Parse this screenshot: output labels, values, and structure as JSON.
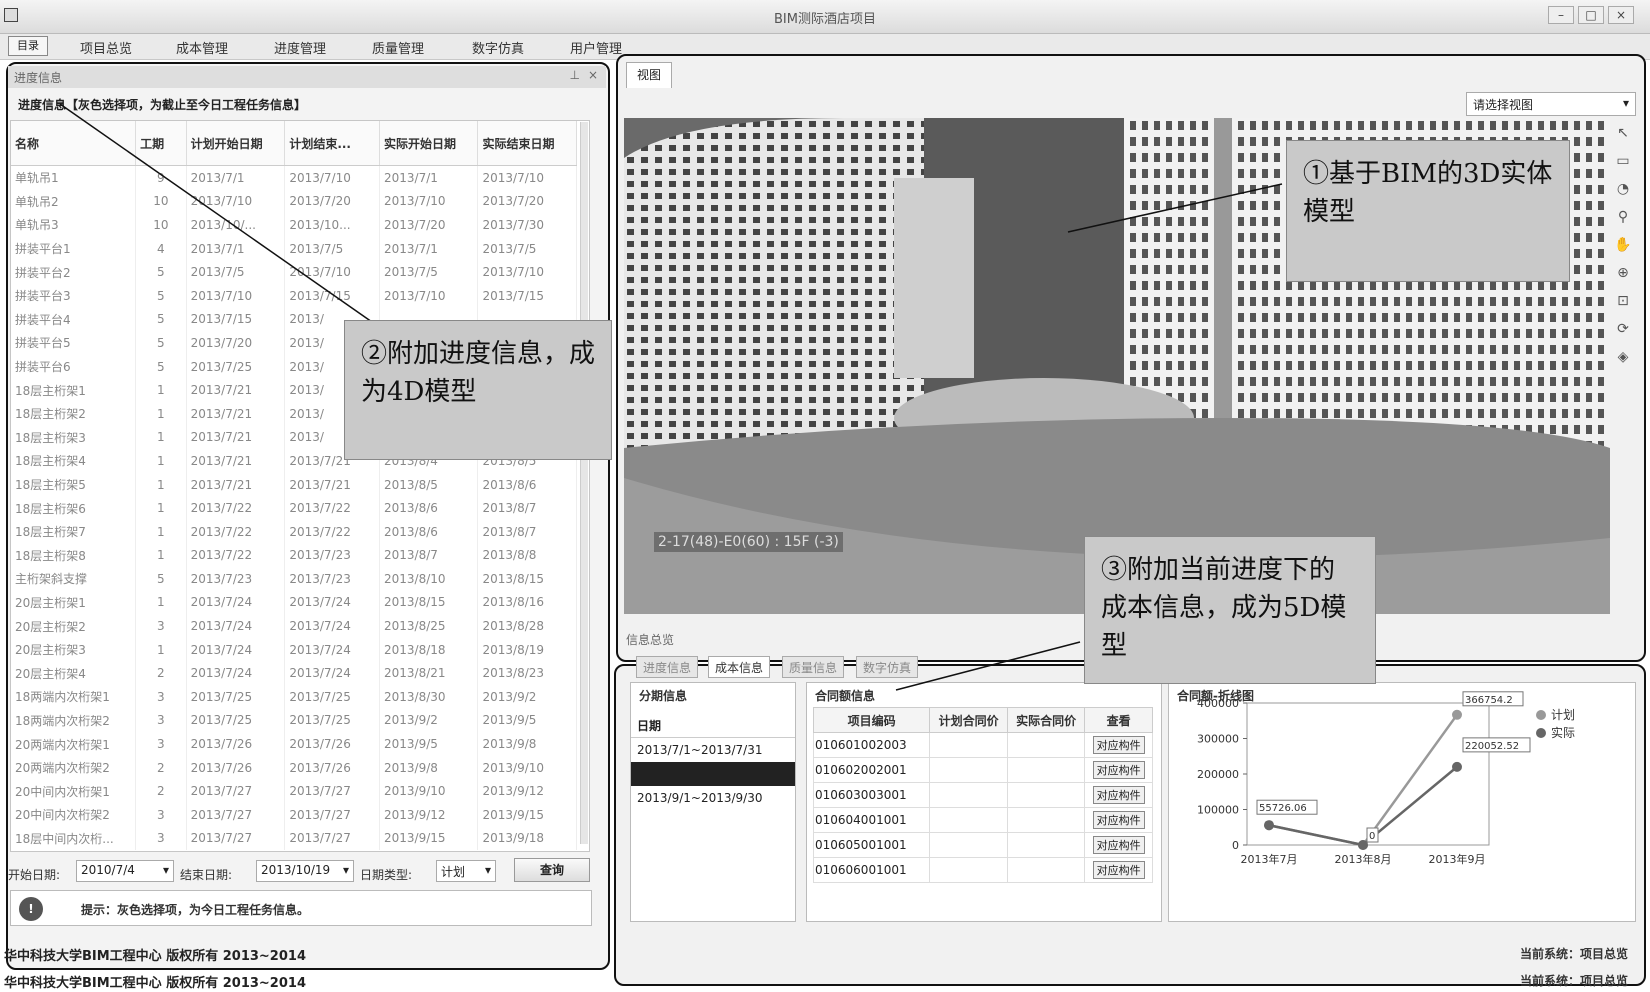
{
  "window": {
    "title": "BIM测际酒店项目",
    "min": "–",
    "max": "□",
    "close": "×"
  },
  "menu": {
    "home_label": "目录",
    "items": [
      "项目总览",
      "成本管理",
      "进度管理",
      "质量管理",
      "数字仿真",
      "用户管理"
    ]
  },
  "left": {
    "panel_title": "进度信息",
    "caption": "进度信息【灰色选择项，为截止至今日工程任务信息】",
    "columns": [
      "名称",
      "工期",
      "计划开始日期",
      "计划结束...",
      "实际开始日期",
      "实际结束日期"
    ],
    "rows": [
      [
        "单轨吊1",
        "9",
        "2013/7/1",
        "2013/7/10",
        "2013/7/1",
        "2013/7/10"
      ],
      [
        "单轨吊2",
        "10",
        "2013/7/10",
        "2013/7/20",
        "2013/7/10",
        "2013/7/20"
      ],
      [
        "单轨吊3",
        "10",
        "2013/10/...",
        "2013/10...",
        "2013/7/20",
        "2013/7/30"
      ],
      [
        "拼装平台1",
        "4",
        "2013/7/1",
        "2013/7/5",
        "2013/7/1",
        "2013/7/5"
      ],
      [
        "拼装平台2",
        "5",
        "2013/7/5",
        "2013/7/10",
        "2013/7/5",
        "2013/7/10"
      ],
      [
        "拼装平台3",
        "5",
        "2013/7/10",
        "2013/7/15",
        "2013/7/10",
        "2013/7/15"
      ],
      [
        "拼装平台4",
        "5",
        "2013/7/15",
        "2013/",
        "",
        ""
      ],
      [
        "拼装平台5",
        "5",
        "2013/7/20",
        "2013/",
        "",
        ""
      ],
      [
        "拼装平台6",
        "5",
        "2013/7/25",
        "2013/",
        "",
        ""
      ],
      [
        "18层主桁架1",
        "1",
        "2013/7/21",
        "2013/",
        "",
        ""
      ],
      [
        "18层主桁架2",
        "1",
        "2013/7/21",
        "2013/",
        "",
        ""
      ],
      [
        "18层主桁架3",
        "1",
        "2013/7/21",
        "2013/",
        "",
        ""
      ],
      [
        "18层主桁架4",
        "1",
        "2013/7/21",
        "2013/7/21",
        "2013/8/4",
        "2013/8/5"
      ],
      [
        "18层主桁架5",
        "1",
        "2013/7/21",
        "2013/7/21",
        "2013/8/5",
        "2013/8/6"
      ],
      [
        "18层主桁架6",
        "1",
        "2013/7/22",
        "2013/7/22",
        "2013/8/6",
        "2013/8/7"
      ],
      [
        "18层主桁架7",
        "1",
        "2013/7/22",
        "2013/7/22",
        "2013/8/6",
        "2013/8/7"
      ],
      [
        "18层主桁架8",
        "1",
        "2013/7/22",
        "2013/7/23",
        "2013/8/7",
        "2013/8/8"
      ],
      [
        "主桁架斜支撑",
        "5",
        "2013/7/23",
        "2013/7/23",
        "2013/8/10",
        "2013/8/15"
      ],
      [
        "20层主桁架1",
        "1",
        "2013/7/24",
        "2013/7/24",
        "2013/8/15",
        "2013/8/16"
      ],
      [
        "20层主桁架2",
        "3",
        "2013/7/24",
        "2013/7/24",
        "2013/8/25",
        "2013/8/28"
      ],
      [
        "20层主桁架3",
        "1",
        "2013/7/24",
        "2013/7/24",
        "2013/8/18",
        "2013/8/19"
      ],
      [
        "20层主桁架4",
        "2",
        "2013/7/24",
        "2013/7/24",
        "2013/8/21",
        "2013/8/23"
      ],
      [
        "18两端内次桁架1",
        "3",
        "2013/7/25",
        "2013/7/25",
        "2013/8/30",
        "2013/9/2"
      ],
      [
        "18两端内次桁架2",
        "3",
        "2013/7/25",
        "2013/7/25",
        "2013/9/2",
        "2013/9/5"
      ],
      [
        "20两端内次桁架1",
        "3",
        "2013/7/26",
        "2013/7/26",
        "2013/9/5",
        "2013/9/8"
      ],
      [
        "20两端内次桁架2",
        "2",
        "2013/7/26",
        "2013/7/26",
        "2013/9/8",
        "2013/9/10"
      ],
      [
        "20中间内次桁架1",
        "2",
        "2013/7/27",
        "2013/7/27",
        "2013/9/10",
        "2013/9/12"
      ],
      [
        "20中间内次桁架2",
        "3",
        "2013/7/27",
        "2013/7/27",
        "2013/9/12",
        "2013/9/15"
      ],
      [
        "18层中间内次桁...",
        "3",
        "2013/7/27",
        "2013/7/27",
        "2013/9/15",
        "2013/9/18"
      ]
    ],
    "filter": {
      "start_label": "开始日期:",
      "start_value": "2010/7/4",
      "end_label": "结束日期:",
      "end_value": "2013/10/19",
      "type_label": "日期类型:",
      "type_value": "计划",
      "query": "查询"
    },
    "tip": "提示：灰色选择项，为今日工程任务信息。"
  },
  "view": {
    "tab": "视图",
    "select_placeholder": "请选择视图",
    "coord_readout": "2-17(48)-E0(60) : 15F (-3)"
  },
  "info": {
    "panel_title": "信息总览",
    "tabs": [
      "进度信息",
      "成本信息",
      "质量信息",
      "数字仿真"
    ],
    "period": {
      "title": "分期信息",
      "col": "日期",
      "rows": [
        "2013/7/1~2013/7/31",
        "",
        "2013/9/1~2013/9/30"
      ]
    },
    "contract": {
      "title": "合同额信息",
      "columns": [
        "项目编码",
        "计划合同价",
        "实际合同价",
        "查看"
      ],
      "codes": [
        "010601002003",
        "010602002001",
        "010603003001",
        "010604001001",
        "010605001001",
        "010606001001"
      ],
      "button": "对应构件"
    }
  },
  "chart_data": {
    "type": "line",
    "title": "合同额-折线图",
    "categories": [
      "2013年7月",
      "2013年8月",
      "2013年9月"
    ],
    "series": [
      {
        "name": "计划",
        "values": [
          55726.06,
          0,
          366754.2
        ]
      },
      {
        "name": "实际",
        "values": [
          55726.06,
          0,
          220052.52
        ]
      }
    ],
    "point_labels": [
      "55726.06",
      "0",
      "366754.2",
      "220052.52"
    ],
    "ylim": [
      0,
      400000
    ],
    "yticks": [
      0,
      100000,
      200000,
      300000,
      400000
    ],
    "legend": "top-right",
    "colors": {
      "plan": "#999999",
      "actual": "#666666"
    }
  },
  "footer": {
    "copyright": "华中科技大学BIM工程中心 版权所有 2013~2014",
    "status": "当前系统：项目总览"
  },
  "callouts": {
    "c1": "①基于BIM的3D实体模型",
    "c2": "②附加进度信息，成为4D模型",
    "c3": "③附加当前进度下的成本信息，成为5D模型"
  }
}
